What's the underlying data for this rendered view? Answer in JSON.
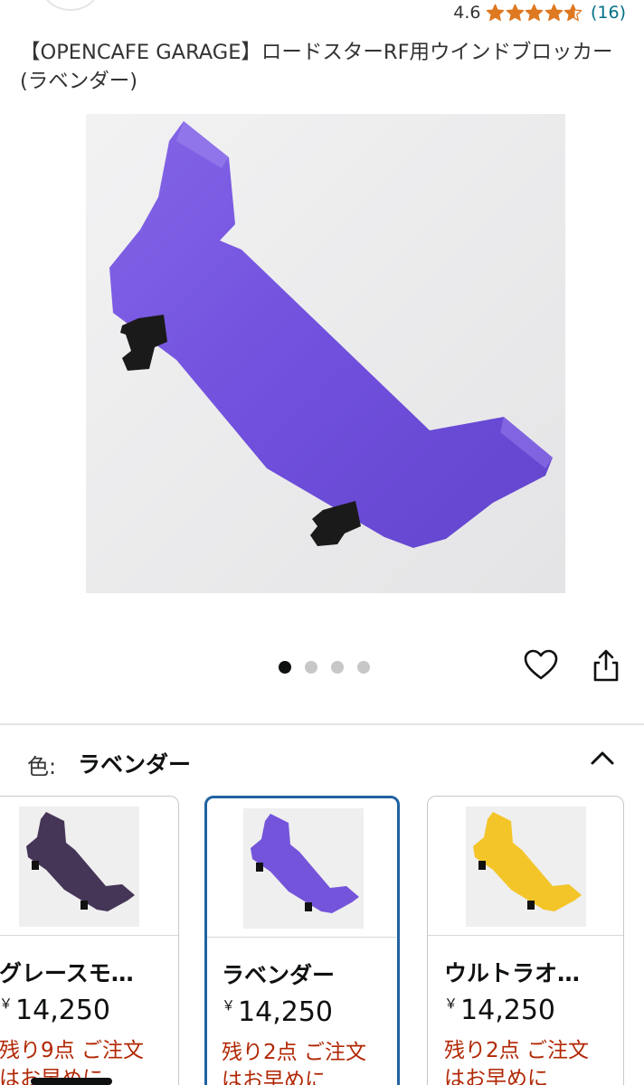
{
  "rating": {
    "score": "4.6",
    "stars_value": 4.6,
    "count": "(16)",
    "star_color": "#de7921"
  },
  "product": {
    "title": "【OPENCAFE GARAGE】ロードスターRF用ウインドブロッカー (ラベンダー)"
  },
  "gallery": {
    "dot_count": 4,
    "active_index": 0,
    "icons": [
      "heart-icon",
      "share-icon"
    ]
  },
  "variation": {
    "label": "色:",
    "selected": "ラベンダー",
    "toggle_icon": "chevron-up-icon",
    "swatches": [
      {
        "name": "グレースモ…",
        "yen": "￥",
        "price": "14,250",
        "stock_line1": "残り9点 ご注文",
        "stock_line2": "はお早めに",
        "color": "#3b2a4e",
        "selected": false
      },
      {
        "name": "ラベンダー",
        "yen": "￥",
        "price": "14,250",
        "stock_line1": "残り2点 ご注文",
        "stock_line2": "はお早めに",
        "color": "#6d4bd8",
        "selected": true
      },
      {
        "name": "ウルトラオ…",
        "yen": "￥",
        "price": "14,250",
        "stock_line1": "残り2点 ご注文",
        "stock_line2": "はお早めに",
        "color": "#f3c21d",
        "selected": false
      }
    ]
  },
  "colors": {
    "link": "#007185",
    "accent_border": "#2162a1",
    "stock_red": "#b12704",
    "product_purple": "#6d4bd8"
  }
}
